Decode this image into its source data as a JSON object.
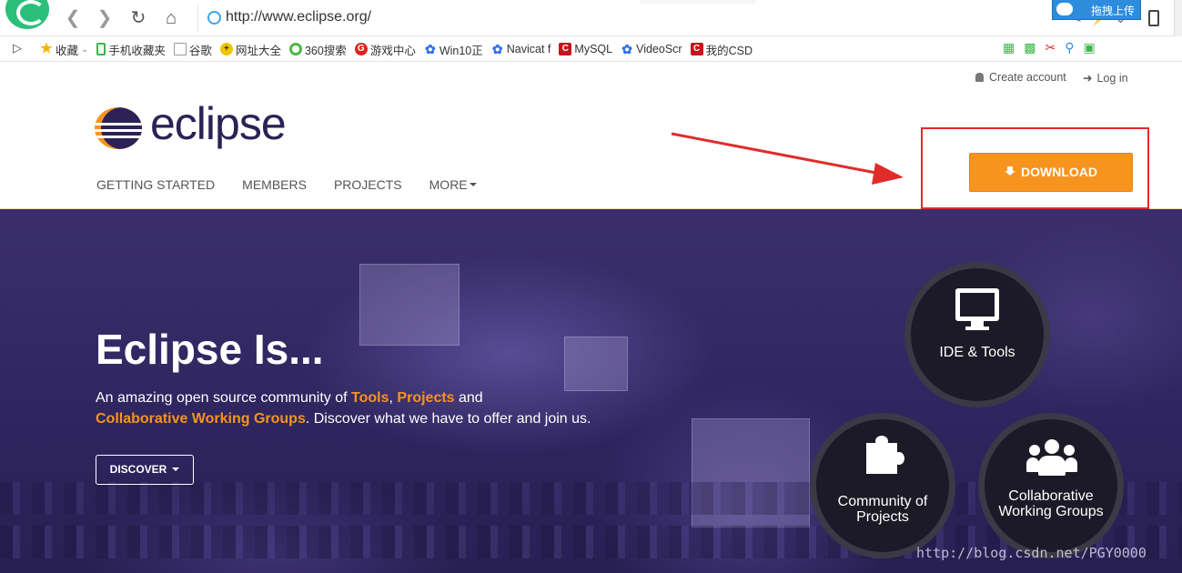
{
  "browser": {
    "url": "http://www.eclipse.org/",
    "upload_label": "拖拽上传",
    "bookmarks": [
      {
        "label": "收藏",
        "icon": "star-icon"
      },
      {
        "label": "手机收藏夹",
        "icon": "phone-icon"
      },
      {
        "label": "谷歌",
        "icon": "document-icon"
      },
      {
        "label": "网址大全",
        "icon": "wangzhi-icon"
      },
      {
        "label": "360搜索",
        "icon": "search-360-icon"
      },
      {
        "label": "游戏中心",
        "icon": "game-icon"
      },
      {
        "label": "Win10正",
        "icon": "baidu-paw-icon"
      },
      {
        "label": "Navicat f",
        "icon": "baidu-paw-icon"
      },
      {
        "label": "MySQL",
        "icon": "csdn-icon"
      },
      {
        "label": "VideoScr",
        "icon": "baidu-paw-icon"
      },
      {
        "label": "我的CSD",
        "icon": "csdn-icon"
      }
    ]
  },
  "header": {
    "create_account": "Create account",
    "login": "Log in",
    "logo_text": "eclipse",
    "nav": [
      "GETTING STARTED",
      "MEMBERS",
      "PROJECTS",
      "MORE"
    ],
    "download_label": "DOWNLOAD"
  },
  "hero": {
    "title": "Eclipse Is...",
    "text_prefix": "An amazing open source community of ",
    "tools": "Tools",
    "comma": ",",
    "projects": "Projects",
    "and": " and",
    "working_groups": "Collaborative Working Groups",
    "text_suffix": ". Discover what we have to offer and join us.",
    "discover_label": "DISCOVER",
    "circles": [
      {
        "label": "IDE & Tools",
        "icon": "monitor-icon"
      },
      {
        "label": "Community of Projects",
        "icon": "puzzle-icon"
      },
      {
        "label": "Collaborative Working Groups",
        "icon": "group-icon"
      }
    ]
  },
  "watermark": "http://blog.csdn.net/PGY0000",
  "colors": {
    "accent": "#f7941e",
    "brand_dark": "#2c2255",
    "annotation_red": "#e02b2b"
  }
}
